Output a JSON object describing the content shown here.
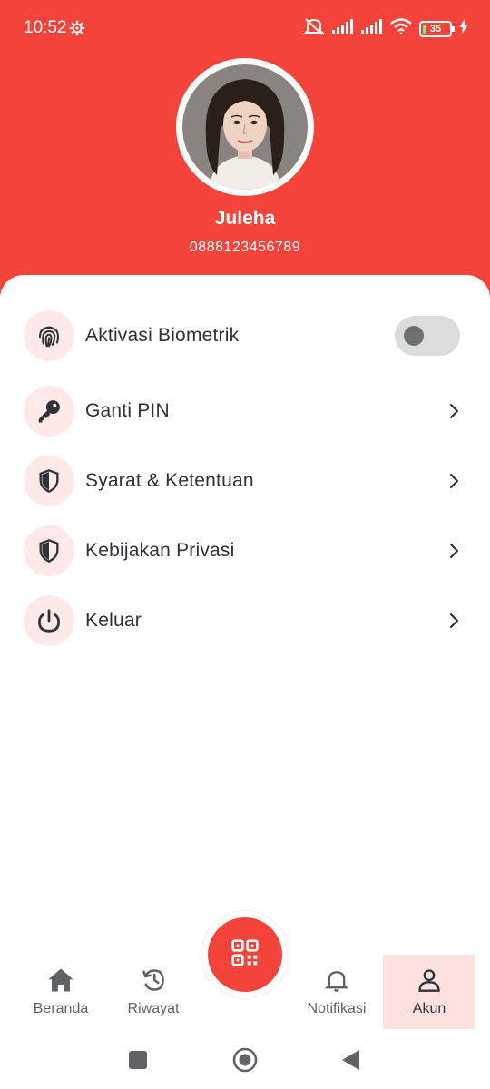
{
  "status_bar": {
    "time": "10:52",
    "battery_level": "35",
    "icons": [
      "settings-gear-icon",
      "mute-icon",
      "signal-icon",
      "signal-icon",
      "wifi-icon",
      "battery-icon",
      "charging-bolt-icon"
    ]
  },
  "profile": {
    "name": "Juleha",
    "phone": "0888123456789",
    "avatar": "avatar-photo"
  },
  "menu": {
    "items": [
      {
        "label": "Aktivasi Biometrik",
        "icon": "fingerprint-icon",
        "control": "toggle",
        "enabled": false
      },
      {
        "label": "Ganti PIN",
        "icon": "key-icon",
        "control": "chevron"
      },
      {
        "label": "Syarat & Ketentuan",
        "icon": "shield-icon",
        "control": "chevron"
      },
      {
        "label": "Kebijakan Privasi",
        "icon": "shield-icon",
        "control": "chevron"
      },
      {
        "label": "Keluar",
        "icon": "power-icon",
        "control": "chevron"
      }
    ]
  },
  "bottom_nav": {
    "items": [
      {
        "label": "Beranda",
        "icon": "home-icon",
        "active": false
      },
      {
        "label": "Riwayat",
        "icon": "history-icon",
        "active": false
      },
      {
        "label": "Notifikasi",
        "icon": "bell-icon",
        "active": false
      },
      {
        "label": "Akun",
        "icon": "user-icon",
        "active": true
      }
    ],
    "fab_icon": "qr-code-icon"
  },
  "colors": {
    "primary": "#f4433a",
    "icon_bg": "#fde9e7",
    "active_nav_bg": "#fde1df",
    "text": "#2f3336",
    "muted": "#5f6368"
  }
}
